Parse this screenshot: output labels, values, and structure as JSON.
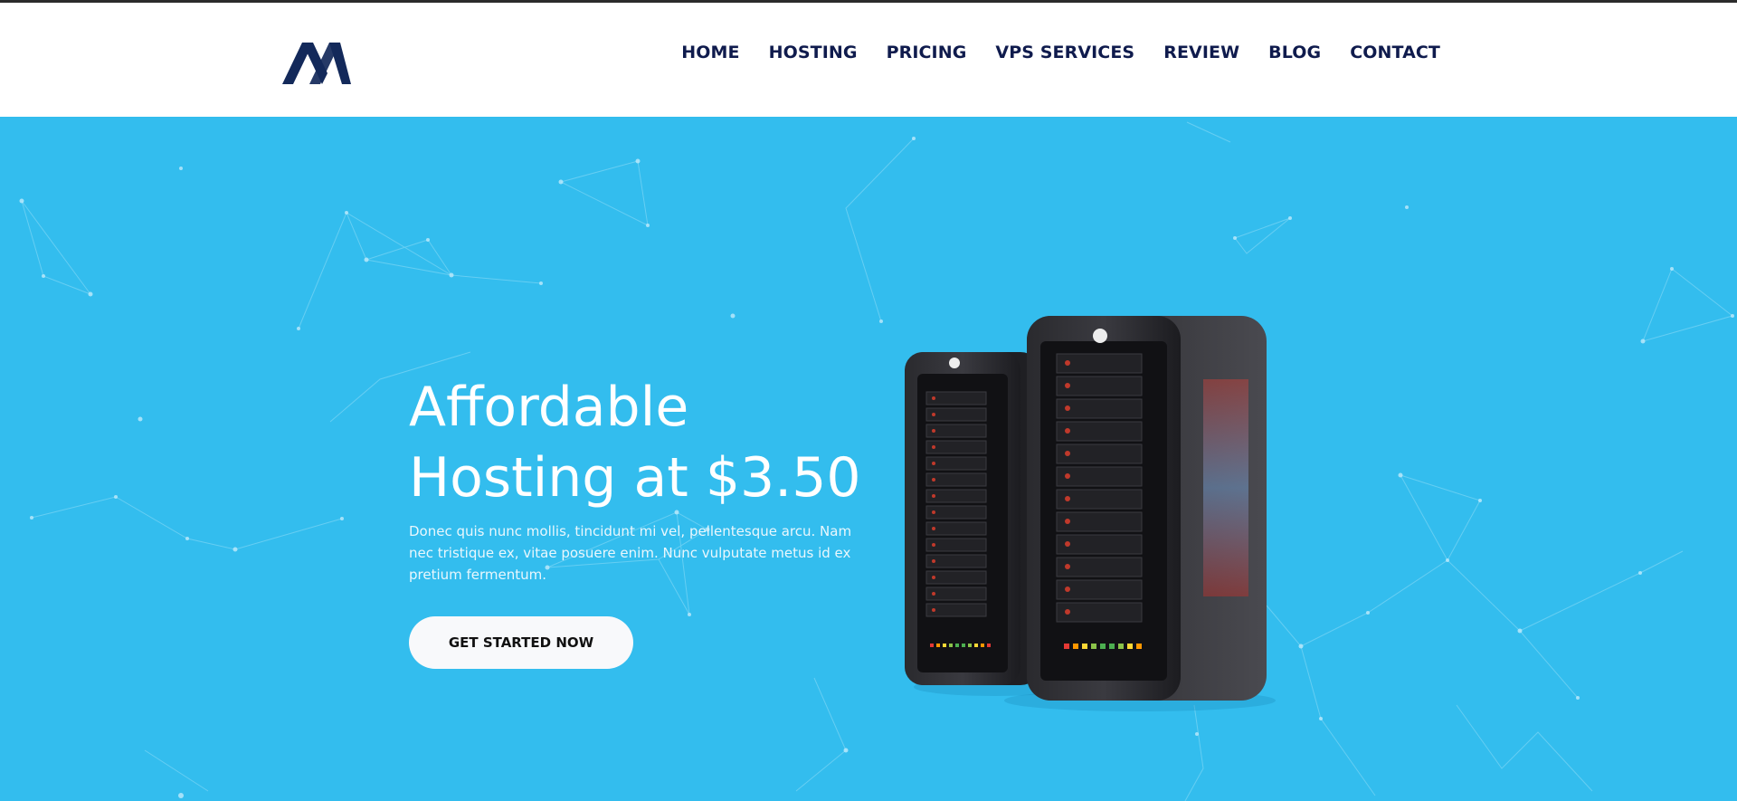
{
  "brand": {
    "logo_icon": "brand-logo-m-icon",
    "color": "#13295a"
  },
  "nav": {
    "items": [
      {
        "label": "HOME"
      },
      {
        "label": "HOSTING"
      },
      {
        "label": "PRICING"
      },
      {
        "label": "VPS SERVICES"
      },
      {
        "label": "REVIEW"
      },
      {
        "label": "BLOG"
      },
      {
        "label": "CONTACT"
      }
    ],
    "color": "#0f1b4d"
  },
  "hero": {
    "title_line1": "Affordable",
    "title_line2": "Hosting at $3.50",
    "description": "Donec quis nunc mollis, tincidunt mi vel, pellentesque arcu. Nam nec tristique ex, vitae posuere enim. Nunc vulputate metus id ex pretium fermentum.",
    "cta_label": "GET STARTED NOW",
    "background": "#33bdee",
    "image": "server-towers-illustration"
  }
}
